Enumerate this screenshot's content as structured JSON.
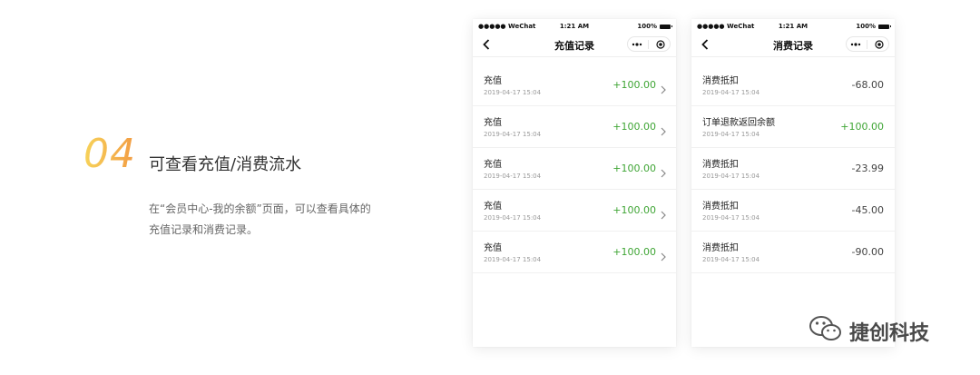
{
  "feature": {
    "number": "04",
    "title": "可查看充值/消费流水",
    "description": "在“会员中心-我的余额”页面，可以查看具体的充值记录和消费记录。",
    "number_gradient": [
      "#f7d35a",
      "#f29b43"
    ]
  },
  "colors": {
    "positive": "#3fa535",
    "negative": "#444444"
  },
  "phones": [
    {
      "status": {
        "carrier": "●●●●● WeChat",
        "time": "1:21 AM",
        "battery": "100%"
      },
      "nav_title": "充值记录",
      "rows": [
        {
          "title": "充值",
          "date": "2019-04-17 15:04",
          "amount": "+100.00"
        },
        {
          "title": "充值",
          "date": "2019-04-17 15:04",
          "amount": "+100.00"
        },
        {
          "title": "充值",
          "date": "2019-04-17 15:04",
          "amount": "+100.00"
        },
        {
          "title": "充值",
          "date": "2019-04-17 15:04",
          "amount": "+100.00"
        },
        {
          "title": "充值",
          "date": "2019-04-17 15:04",
          "amount": "+100.00"
        }
      ]
    },
    {
      "status": {
        "carrier": "●●●●● WeChat",
        "time": "1:21 AM",
        "battery": "100%"
      },
      "nav_title": "消费记录",
      "rows": [
        {
          "title": "消费抵扣",
          "date": "2019-04-17 15:04",
          "amount": "-68.00"
        },
        {
          "title": "订单退款返回余额",
          "date": "2019-04-17 15:04",
          "amount": "+100.00"
        },
        {
          "title": "消费抵扣",
          "date": "2019-04-17 15:04",
          "amount": "-23.99"
        },
        {
          "title": "消费抵扣",
          "date": "2019-04-17 15:04",
          "amount": "-45.00"
        },
        {
          "title": "消费抵扣",
          "date": "2019-04-17 15:04",
          "amount": "-90.00"
        }
      ]
    }
  ],
  "watermark": {
    "text": "捷创科技",
    "icon": "wechat-icon"
  }
}
